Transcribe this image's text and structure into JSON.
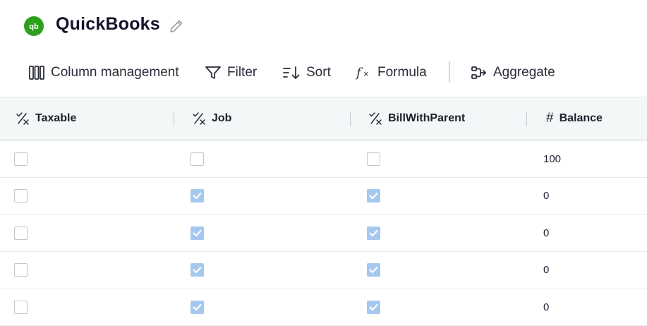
{
  "app": {
    "title": "QuickBooks"
  },
  "toolbar": {
    "column_management": "Column management",
    "filter": "Filter",
    "sort": "Sort",
    "formula": "Formula",
    "aggregate": "Aggregate"
  },
  "columns": [
    {
      "label": "Taxable",
      "type_icon": "boolean-type-icon"
    },
    {
      "label": "Job",
      "type_icon": "boolean-type-icon"
    },
    {
      "label": "BillWithParent",
      "type_icon": "boolean-type-icon"
    },
    {
      "label": "Balance",
      "type_icon": "number-type-icon",
      "icon_glyph": "#"
    }
  ],
  "rows": [
    {
      "taxable": false,
      "job": false,
      "bill_with_parent": false,
      "balance": "100"
    },
    {
      "taxable": false,
      "job": true,
      "bill_with_parent": true,
      "balance": "0"
    },
    {
      "taxable": false,
      "job": true,
      "bill_with_parent": true,
      "balance": "0"
    },
    {
      "taxable": false,
      "job": true,
      "bill_with_parent": true,
      "balance": "0"
    },
    {
      "taxable": false,
      "job": true,
      "bill_with_parent": true,
      "balance": "0"
    }
  ],
  "colors": {
    "brand": "#2ca01c",
    "checkbox_checked": "#a6c8ee",
    "header_bg": "#f4f7f7"
  }
}
